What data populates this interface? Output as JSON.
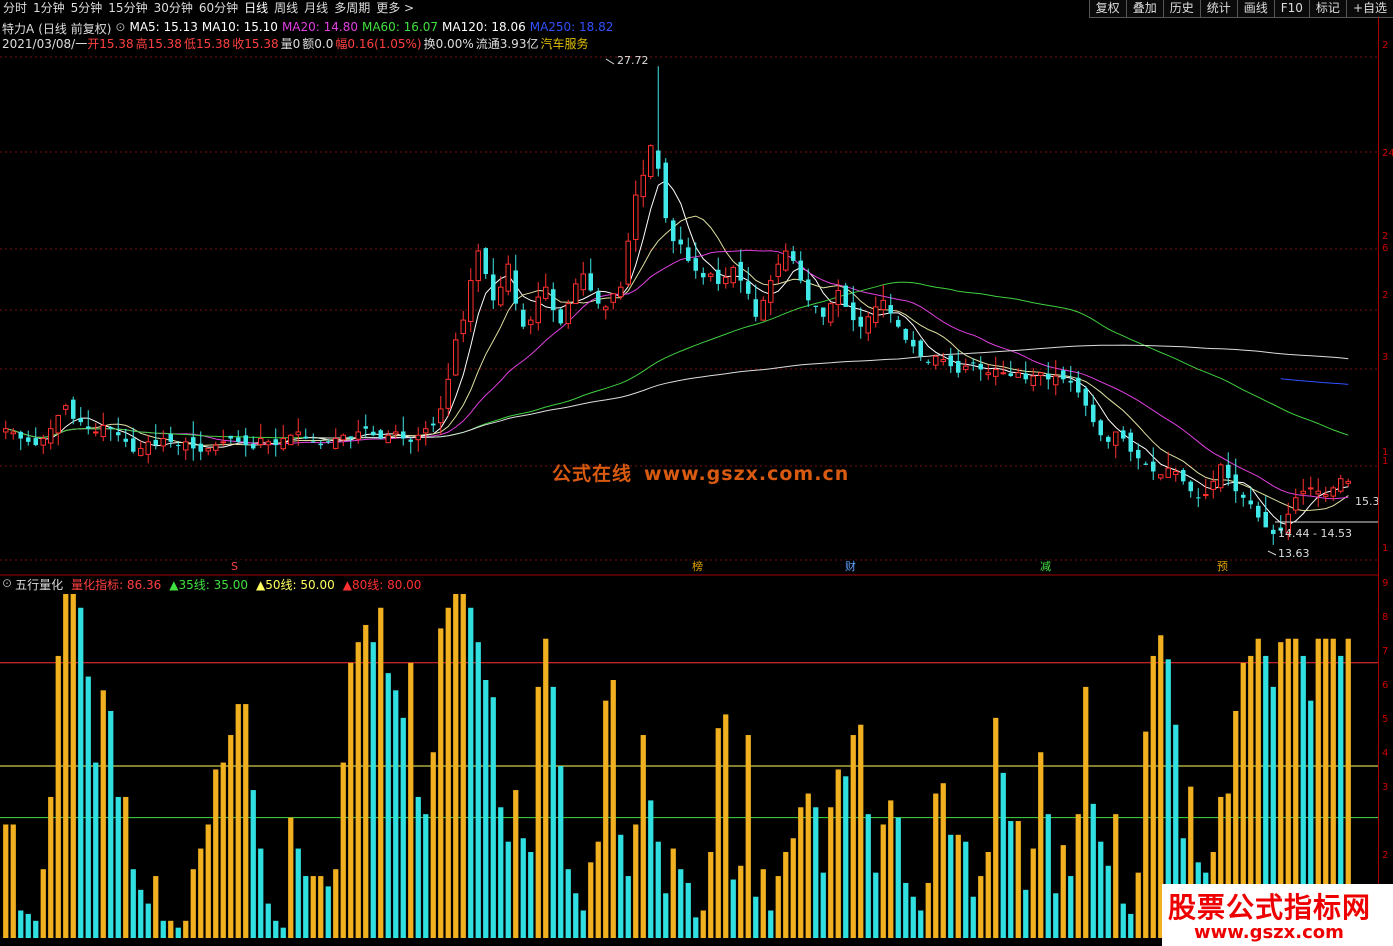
{
  "toolbar": {
    "periods": [
      {
        "label": "分时"
      },
      {
        "label": "1分钟"
      },
      {
        "label": "5分钟"
      },
      {
        "label": "15分钟"
      },
      {
        "label": "30分钟"
      },
      {
        "label": "60分钟"
      },
      {
        "label": "日线",
        "active": true
      },
      {
        "label": "周线"
      },
      {
        "label": "月线"
      },
      {
        "label": "多周期"
      },
      {
        "label": "更多 >"
      }
    ],
    "buttons": [
      "复权",
      "叠加",
      "历史",
      "统计",
      "画线",
      "F10",
      "标记",
      "+自选"
    ]
  },
  "info": {
    "stock_name": "特力A",
    "chart_mode": "(日线 前复权)",
    "ma": [
      {
        "label": "MA5: 15.13",
        "color": "#ffffff"
      },
      {
        "label": "MA10: 15.10",
        "color": "#ffffff"
      },
      {
        "label": "MA20: 14.80",
        "color": "#e040e0"
      },
      {
        "label": "MA60: 16.07",
        "color": "#40e040"
      },
      {
        "label": "MA120: 18.06",
        "color": "#ffffff"
      },
      {
        "label": "MA250: 18.82",
        "color": "#3050ff"
      }
    ],
    "line2": [
      {
        "label": "2021/03/08/一",
        "color": "#dddddd"
      },
      {
        "label": "开15.38",
        "color": "#ff4040"
      },
      {
        "label": "高15.38",
        "color": "#ff4040"
      },
      {
        "label": "低15.38",
        "color": "#ff4040"
      },
      {
        "label": "收15.38",
        "color": "#ff4040"
      },
      {
        "label": "量0",
        "color": "#dddddd"
      },
      {
        "label": "额0.0",
        "color": "#dddddd"
      },
      {
        "label": "幅0.16(1.05%)",
        "color": "#ff4040"
      },
      {
        "label": "换0.00%",
        "color": "#dddddd"
      },
      {
        "label": "流通3.93亿",
        "color": "#dddddd"
      },
      {
        "label": "汽车服务",
        "color": "#e0c000"
      }
    ]
  },
  "price_annotations": {
    "high": "27.72",
    "low": "13.63",
    "range": "14.44 - 14.53",
    "last": "15.3"
  },
  "event_markers": [
    {
      "label": "S",
      "color": "#ff4040"
    },
    {
      "label": "榜",
      "color": "#e0a000"
    },
    {
      "label": "财",
      "color": "#60a0ff"
    },
    {
      "label": "减",
      "color": "#40e040"
    },
    {
      "label": "预",
      "color": "#e0a000"
    }
  ],
  "right_axis_labels": [
    "2",
    "24.",
    "2",
    "6",
    "2",
    "3",
    "1",
    "1",
    "1",
    "9",
    "8",
    "7",
    "6",
    "5",
    "4",
    "3",
    "2"
  ],
  "indicator": {
    "name": "五行量化",
    "items": [
      {
        "label": "量化指标: 86.36",
        "color": "#ff4040"
      },
      {
        "label": "▲35线: 35.00",
        "color": "#40e040"
      },
      {
        "label": "▲50线: 50.00",
        "color": "#ffff60"
      },
      {
        "label": "▲80线: 80.00",
        "color": "#ff3030"
      }
    ]
  },
  "watermark": {
    "title": "公式在线",
    "url": "www.gszx.com.cn"
  },
  "logo": {
    "title": "股票公式指标网",
    "url": "www.gszx.com"
  },
  "chart_data": [
    {
      "type": "candlestick",
      "title": "特力A (日线 前复权)",
      "ylim": [
        13.0,
        28.5
      ],
      "annotations": {
        "max": 27.72,
        "min": 13.63
      },
      "closes": [
        16.9,
        16.8,
        16.6,
        16.5,
        16.4,
        16.6,
        16.9,
        17.3,
        17.6,
        17.2,
        17.1,
        16.9,
        16.8,
        17.0,
        16.9,
        16.7,
        16.5,
        16.2,
        16.3,
        16.5,
        16.4,
        16.6,
        16.5,
        16.4,
        16.5,
        16.3,
        16.2,
        16.3,
        16.4,
        16.5,
        16.6,
        16.5,
        16.4,
        16.3,
        16.6,
        16.5,
        16.4,
        16.6,
        16.7,
        16.8,
        16.6,
        16.5,
        16.4,
        16.5,
        16.6,
        16.7,
        16.6,
        16.8,
        16.9,
        16.7,
        16.6,
        16.7,
        16.8,
        16.6,
        16.5,
        16.7,
        16.9,
        17.0,
        17.5,
        18.4,
        19.6,
        20.2,
        21.4,
        22.3,
        21.6,
        20.8,
        21.2,
        21.9,
        20.7,
        20.0,
        20.2,
        20.9,
        21.2,
        20.5,
        20.1,
        20.7,
        21.3,
        21.6,
        21.1,
        20.7,
        20.6,
        21.0,
        21.2,
        22.6,
        24.0,
        24.6,
        25.5,
        24.8,
        23.3,
        22.6,
        22.5,
        22.0,
        21.7,
        21.5,
        21.6,
        21.3,
        21.5,
        21.8,
        21.4,
        21.0,
        20.3,
        20.8,
        21.4,
        21.9,
        22.3,
        22.0,
        21.4,
        20.8,
        20.6,
        20.3,
        20.7,
        21.1,
        20.6,
        20.2,
        20.0,
        20.3,
        20.6,
        20.8,
        20.4,
        20.0,
        19.6,
        19.4,
        19.1,
        18.9,
        19.1,
        19.0,
        18.8,
        18.6,
        18.8,
        18.9,
        18.7,
        18.6,
        18.7,
        18.6,
        18.5,
        18.6,
        18.4,
        18.5,
        18.6,
        18.4,
        18.5,
        18.4,
        18.3,
        18.0,
        17.6,
        17.1,
        16.7,
        16.5,
        16.8,
        16.6,
        16.2,
        16.0,
        15.8,
        15.6,
        15.5,
        15.7,
        15.6,
        15.3,
        15.0,
        14.8,
        14.9,
        15.3,
        15.8,
        15.4,
        15.0,
        14.8,
        14.6,
        14.2,
        13.9,
        13.7,
        13.8,
        14.3,
        14.8,
        15.0,
        15.1,
        15.0,
        14.9,
        15.1,
        15.38,
        15.3
      ]
    },
    {
      "type": "bar",
      "title": "五行量化",
      "ylim": [
        0,
        100
      ],
      "reference_lines": [
        35,
        50,
        80
      ],
      "values": [
        33,
        33,
        8,
        7,
        5,
        20,
        41,
        82,
        100,
        100,
        96,
        76,
        51,
        72,
        66,
        41,
        41,
        20,
        14,
        10,
        18,
        5,
        5,
        3,
        5,
        20,
        26,
        33,
        49,
        51,
        59,
        68,
        68,
        43,
        26,
        10,
        5,
        3,
        35,
        26,
        18,
        18,
        18,
        15,
        20,
        51,
        80,
        86,
        91,
        86,
        96,
        77,
        72,
        64,
        80,
        41,
        36,
        54,
        90,
        96,
        100,
        100,
        96,
        86,
        75,
        70,
        38,
        28,
        43,
        29,
        25,
        73,
        87,
        73,
        50,
        20,
        13,
        8,
        22,
        28,
        69,
        75,
        30,
        18,
        33,
        59,
        40,
        28,
        13,
        26,
        20,
        16,
        6,
        8,
        25,
        61,
        65,
        17,
        21,
        59,
        12,
        20,
        8,
        18,
        25,
        29,
        38,
        42,
        38,
        19,
        38,
        49,
        47,
        59,
        62,
        36,
        19,
        33,
        40,
        35,
        16,
        12,
        8,
        16,
        42,
        45,
        30,
        30,
        28,
        12,
        18,
        25,
        64,
        48,
        34,
        34,
        14,
        26,
        54,
        36,
        13,
        27,
        18,
        36,
        73,
        39,
        28,
        21,
        36,
        10,
        7,
        19,
        60,
        82,
        88,
        81,
        62,
        29,
        44,
        22,
        19,
        25,
        41,
        42,
        66,
        80,
        82,
        87,
        82,
        73,
        86,
        87,
        87,
        82,
        69,
        87,
        87,
        87,
        82,
        87
      ]
    }
  ]
}
